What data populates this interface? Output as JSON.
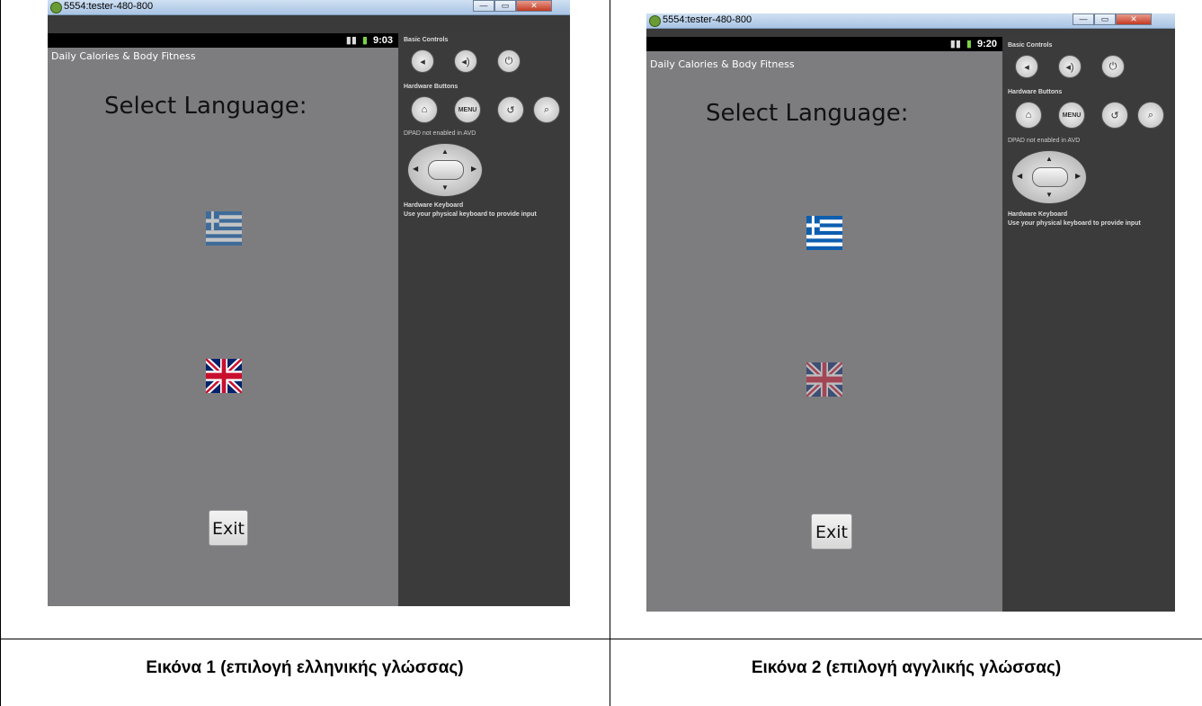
{
  "panels": [
    {
      "window_title": "5554:tester-480-800",
      "clock": "9:03",
      "app_title": "Daily Calories & Body Fitness",
      "heading": "Select Language:",
      "exit_label": "Exit",
      "caption": "Εικόνα 1 (επιλογή ελληνικής γλώσσας)",
      "selected_flag": "greek"
    },
    {
      "window_title": "5554:tester-480-800",
      "clock": "9:20",
      "app_title": "Daily Calories & Body Fitness",
      "heading": "Select Language:",
      "exit_label": "Exit",
      "caption": "Εικόνα 2 (επιλογή αγγλικής γλώσσας)",
      "selected_flag": "english"
    }
  ],
  "emulator": {
    "basic_controls": "Basic Controls",
    "hardware_buttons": "Hardware Buttons",
    "menu_label": "MENU",
    "dpad_note": "DPAD not enabled in AVD",
    "keyboard_title": "Hardware Keyboard",
    "keyboard_note": "Use your physical keyboard to provide input"
  },
  "window_buttons": {
    "minimize": "—",
    "maximize": "▭",
    "close": "✕"
  },
  "colors": {
    "phone_bg": "#7d7d80",
    "side_panel": "#3b3b3b",
    "status_bar": "#000000",
    "greek_blue": "#0d5eaf",
    "uk_blue": "#012169",
    "uk_red": "#c8102e"
  }
}
